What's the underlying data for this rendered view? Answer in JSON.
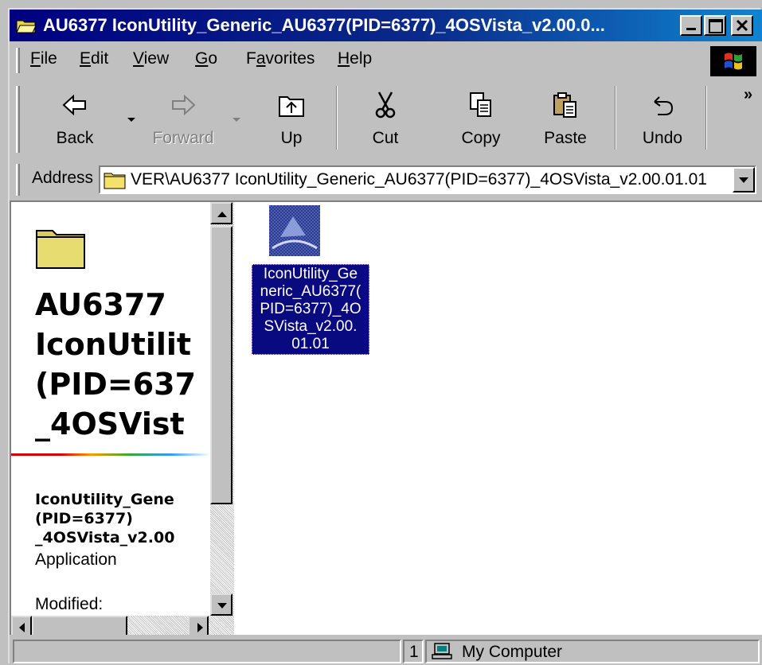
{
  "window": {
    "title": "AU6377 IconUtility_Generic_AU6377(PID=6377)_4OSVista_v2.00.0...",
    "controls": {
      "minimize": "_",
      "maximize": "□",
      "close": "✕"
    }
  },
  "menu": {
    "items": [
      {
        "label": "File",
        "accel": "F",
        "rest": "ile"
      },
      {
        "label": "Edit",
        "accel": "E",
        "rest": "dit"
      },
      {
        "label": "View",
        "accel": "V",
        "rest": "iew"
      },
      {
        "label": "Go",
        "accel": "G",
        "rest": "o"
      },
      {
        "label": "Favorites",
        "pre": "F",
        "accel": "a",
        "rest": "vorites"
      },
      {
        "label": "Help",
        "accel": "H",
        "rest": "elp"
      }
    ]
  },
  "toolbar": {
    "back": "Back",
    "forward": "Forward",
    "up": "Up",
    "cut": "Cut",
    "copy": "Copy",
    "paste": "Paste",
    "undo": "Undo",
    "more": "»"
  },
  "address": {
    "label": "Address",
    "value": "VER\\AU6377 IconUtility_Generic_AU6377(PID=6377)_4OSVista_v2.00.01.01"
  },
  "info_pane": {
    "title_lines": [
      "AU6377",
      "IconUtilit",
      "(PID=637",
      "_4OSVist"
    ],
    "file_name_lines": [
      "IconUtility_Gene",
      "(PID=6377)",
      "_4OSVista_v2.00"
    ],
    "file_type": "Application",
    "modified_label": "Modified:"
  },
  "file": {
    "label_lines": [
      "IconUtility_Ge",
      "neric_AU6377(",
      "PID=6377)_4O",
      "SVista_v2.00.",
      "01.01"
    ],
    "icon": "application-icon",
    "selected": true
  },
  "status": {
    "count": "1",
    "zone": "My Computer",
    "zone_icon": "computer-icon"
  },
  "colors": {
    "title_bar": "#000080",
    "selection": "#0a0a80",
    "face": "#c0c0c0"
  }
}
